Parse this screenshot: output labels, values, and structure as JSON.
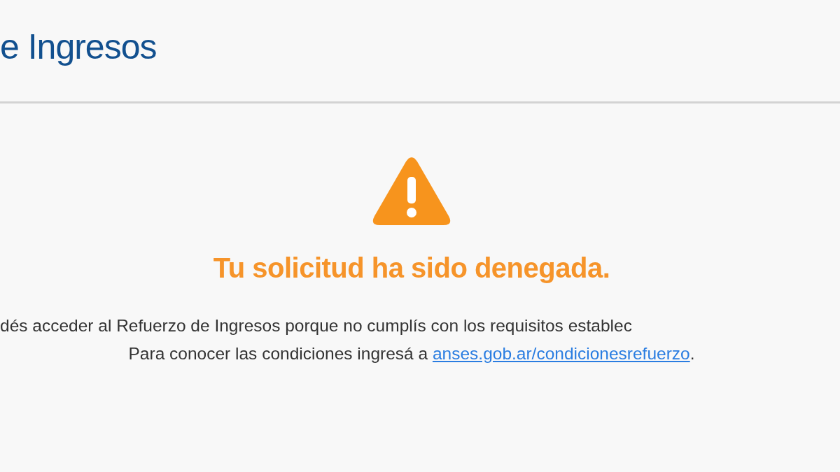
{
  "header": {
    "title": "e Ingresos"
  },
  "message": {
    "heading": "Tu solicitud ha sido denegada.",
    "line_1": "dés acceder al Refuerzo de Ingresos porque no cumplís con los requisitos establec",
    "line_2_text": "Para conocer las condiciones ingresá a ",
    "line_2_link": "anses.gob.ar/condicionesrefuerzo",
    "line_2_end": "."
  }
}
